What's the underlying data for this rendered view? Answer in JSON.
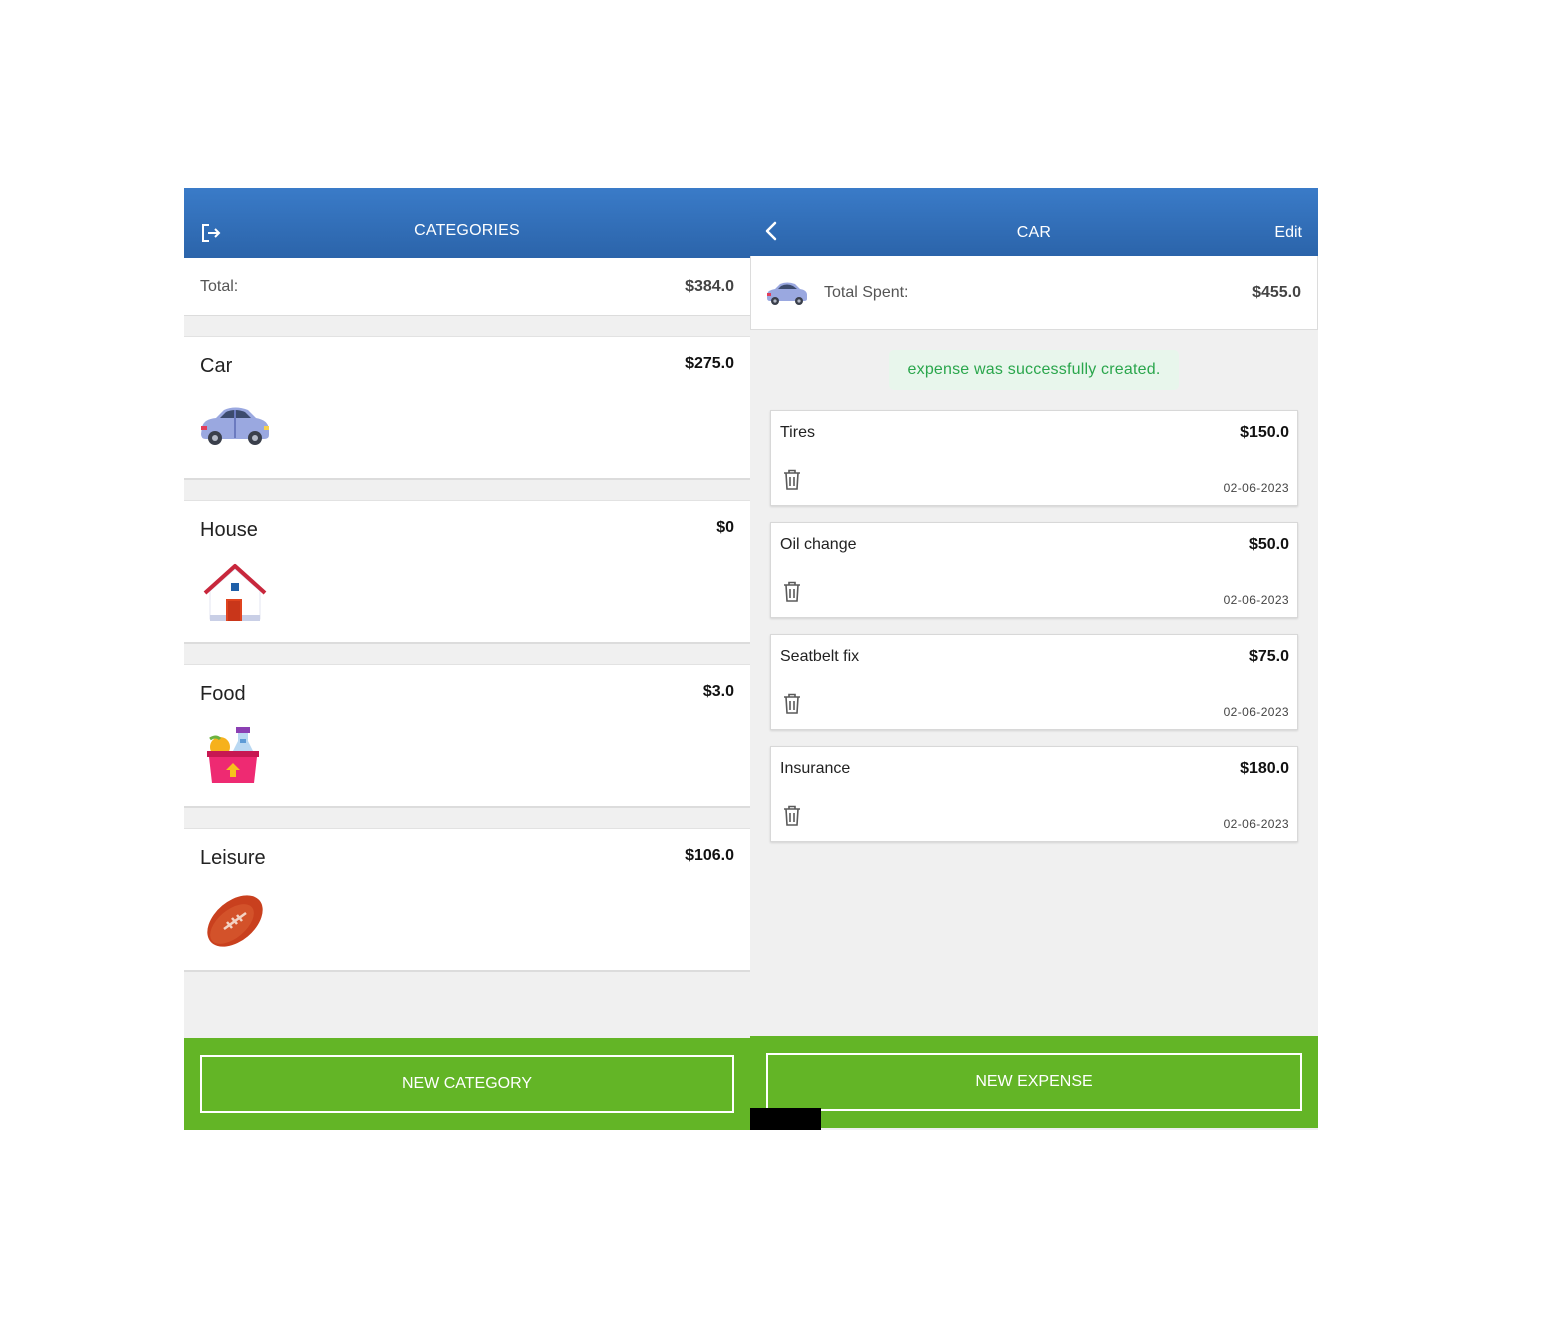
{
  "categories_screen": {
    "header": {
      "title": "CATEGORIES",
      "logout_icon": "logout-icon"
    },
    "summary": {
      "label": "Total:",
      "value": "$384.0"
    },
    "categories": [
      {
        "name": "Car",
        "amount": "$275.0",
        "icon": "car-icon"
      },
      {
        "name": "House",
        "amount": "$0",
        "icon": "house-icon"
      },
      {
        "name": "Food",
        "amount": "$3.0",
        "icon": "grocery-basket-icon"
      },
      {
        "name": "Leisure",
        "amount": "$106.0",
        "icon": "football-icon"
      }
    ],
    "footer": {
      "button_label": "NEW CATEGORY"
    }
  },
  "car_screen": {
    "header": {
      "title": "CAR",
      "back_icon": "chevron-left-icon",
      "edit_label": "Edit"
    },
    "summary": {
      "icon": "car-icon",
      "label": "Total Spent:",
      "value": "$455.0"
    },
    "flash_message": "expense was successfully created.",
    "expenses": [
      {
        "name": "Tires",
        "amount": "$150.0",
        "date": "02-06-2023",
        "icon": "trash-icon"
      },
      {
        "name": "Oil change",
        "amount": "$50.0",
        "date": "02-06-2023",
        "icon": "trash-icon"
      },
      {
        "name": "Seatbelt fix",
        "amount": "$75.0",
        "date": "02-06-2023",
        "icon": "trash-icon"
      },
      {
        "name": "Insurance",
        "amount": "$180.0",
        "date": "02-06-2023",
        "icon": "trash-icon"
      }
    ],
    "footer": {
      "button_label": "NEW EXPENSE"
    }
  },
  "colors": {
    "header_blue": "#2f6cb5",
    "footer_green": "#63b526",
    "flash_green_text": "#2aa64c",
    "flash_green_bg": "#e8f6ec"
  }
}
